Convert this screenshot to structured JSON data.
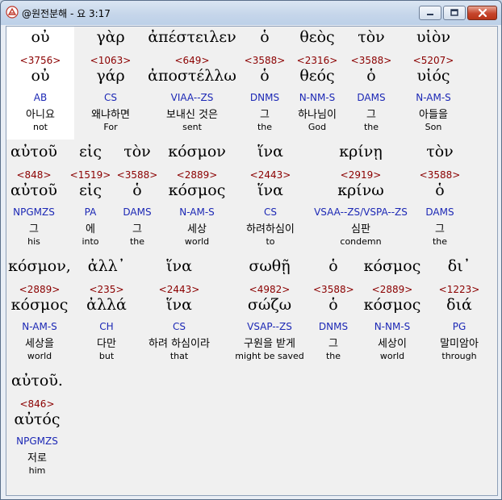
{
  "window": {
    "title": "@원전분해 - 요 3:17",
    "buttons": {
      "minimize": "minimize",
      "maximize": "maximize",
      "close": "close"
    }
  },
  "colors": {
    "greek": "#000000",
    "strong": "#8b0000",
    "morph": "#1c28b5",
    "korean": "#000000",
    "english": "#000000"
  },
  "rows": [
    {
      "words": [
        {
          "greek": "οὐ",
          "strong": "<3756>",
          "lemma": "οὐ",
          "morph": "AB",
          "korean": "아니요",
          "english": "not",
          "highlight": true
        },
        {
          "greek": "γὰρ",
          "strong": "<1063>",
          "lemma": "γάρ",
          "morph": "CS",
          "korean": "왜냐하면",
          "english": "For"
        },
        {
          "greek": "ἀπέστειλεν",
          "strong": "<649>",
          "lemma": "ἀποστέλλω",
          "morph": "VIAA--ZS",
          "korean": "보내신 것은",
          "english": "sent"
        },
        {
          "greek": "ὁ",
          "strong": "<3588>",
          "lemma": "ὁ",
          "morph": "DNMS",
          "korean": "그",
          "english": "the"
        },
        {
          "greek": "θεὸς",
          "strong": "<2316>",
          "lemma": "θεός",
          "morph": "N-NM-S",
          "korean": "하나님이",
          "english": "God"
        },
        {
          "greek": "τὸν",
          "strong": "<3588>",
          "lemma": "ὁ",
          "morph": "DAMS",
          "korean": "그",
          "english": "the"
        },
        {
          "greek": "υἱὸν",
          "strong": "<5207>",
          "lemma": "υἱός",
          "morph": "N-AM-S",
          "korean": "아들을",
          "english": "Son"
        }
      ]
    },
    {
      "words": [
        {
          "greek": "αὐτοῦ",
          "strong": "<848>",
          "lemma": "αὐτοῦ",
          "morph": "NPGMZS",
          "korean": "그",
          "english": "his"
        },
        {
          "greek": "εἰς",
          "strong": "<1519>",
          "lemma": "εἰς",
          "morph": "PA",
          "korean": "에",
          "english": "into"
        },
        {
          "greek": "τὸν",
          "strong": "<3588>",
          "lemma": "ὁ",
          "morph": "DAMS",
          "korean": "그",
          "english": "the"
        },
        {
          "greek": "κόσμον",
          "strong": "<2889>",
          "lemma": "κόσμος",
          "morph": "N-AM-S",
          "korean": "세상",
          "english": "world"
        },
        {
          "greek": "ἵνα",
          "strong": "<2443>",
          "lemma": "ἵνα",
          "morph": "CS",
          "korean": "하려하심이",
          "english": "to"
        },
        {
          "greek": "κρίνῃ",
          "strong": "<2919>",
          "lemma": "κρίνω",
          "morph": "VSAA--ZS/VSPA--ZS",
          "korean": "심판",
          "english": "condemn"
        },
        {
          "greek": "τὸν",
          "strong": "<3588>",
          "lemma": "ὁ",
          "morph": "DAMS",
          "korean": "그",
          "english": "the"
        }
      ]
    },
    {
      "words": [
        {
          "greek": "κόσμον,",
          "strong": "<2889>",
          "lemma": "κόσμος",
          "morph": "N-AM-S",
          "korean": "세상을",
          "english": "world"
        },
        {
          "greek": "ἀλλ᾽",
          "strong": "<235>",
          "lemma": "ἀλλά",
          "morph": "CH",
          "korean": "다만",
          "english": "but"
        },
        {
          "greek": "ἵνα",
          "strong": "<2443>",
          "lemma": "ἵνα",
          "morph": "CS",
          "korean": "하려 하심이라",
          "english": "that"
        },
        {
          "greek": "σωθῇ",
          "strong": "<4982>",
          "lemma": "σώζω",
          "morph": "VSAP--ZS",
          "korean": "구원을 받게",
          "english": "might be saved"
        },
        {
          "greek": "ὁ",
          "strong": "<3588>",
          "lemma": "ὁ",
          "morph": "DNMS",
          "korean": "그",
          "english": "the"
        },
        {
          "greek": "κόσμος",
          "strong": "<2889>",
          "lemma": "κόσμος",
          "morph": "N-NM-S",
          "korean": "세상이",
          "english": "world"
        },
        {
          "greek": "δι᾽",
          "strong": "<1223>",
          "lemma": "διά",
          "morph": "PG",
          "korean": "말미암아",
          "english": "through"
        }
      ]
    },
    {
      "words": [
        {
          "greek": "αὐτοῦ.",
          "strong": "<846>",
          "lemma": "αὐτός",
          "morph": "NPGMZS",
          "korean": "저로",
          "english": "him"
        }
      ]
    }
  ]
}
